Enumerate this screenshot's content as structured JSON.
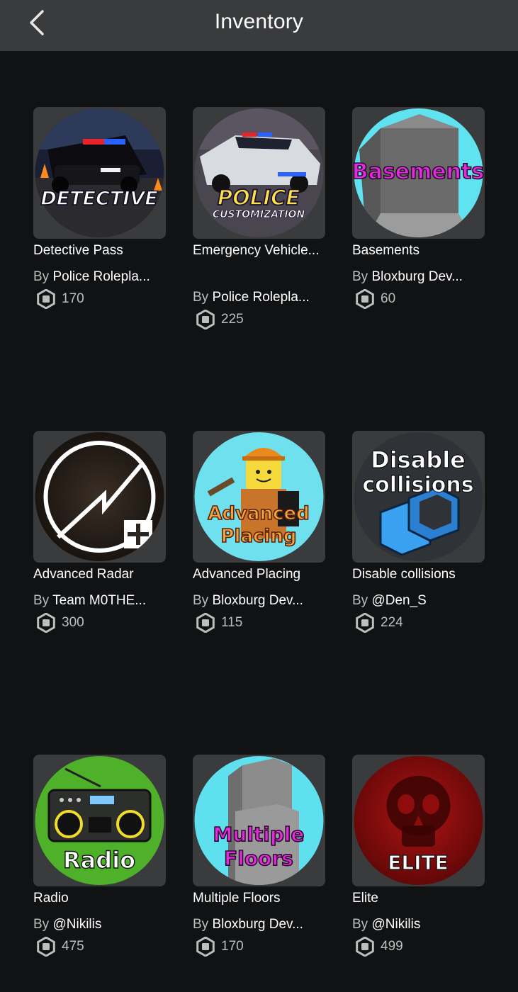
{
  "header": {
    "title": "Inventory"
  },
  "by_prefix": "By",
  "items": [
    {
      "name": "Detective Pass",
      "by": "By",
      "creator": "Police Rolepla...",
      "price": "170",
      "icon": "detective-thumbnail",
      "thumb_text": "DETECTIVE"
    },
    {
      "name": "Emergency Vehicle...",
      "by": "By",
      "creator": "Police Rolepla...",
      "price": "225",
      "icon": "police-customization-thumbnail",
      "thumb_text": "POLICE",
      "thumb_subtext": "CUSTOMIZATION"
    },
    {
      "name": "Basements",
      "by": "By",
      "creator": "Bloxburg Dev...",
      "price": "60",
      "icon": "basements-thumbnail",
      "thumb_text": "Basements"
    },
    {
      "name": "Advanced Radar",
      "by": "By",
      "creator": "Team M0THE...",
      "price": "300",
      "icon": "radar-thumbnail"
    },
    {
      "name": "Advanced Placing",
      "by": "By",
      "creator": "Bloxburg Dev...",
      "price": "115",
      "icon": "advanced-placing-thumbnail",
      "thumb_text": "Advanced",
      "thumb_subtext": "Placing"
    },
    {
      "name": "Disable collisions",
      "by": "By",
      "creator": "@Den_S",
      "price": "224",
      "icon": "disable-collisions-thumbnail",
      "thumb_text": "Disable",
      "thumb_subtext": "collisions"
    },
    {
      "name": "Radio",
      "by": "By",
      "creator": "@Nikilis",
      "price": "475",
      "icon": "radio-thumbnail",
      "thumb_text": "Radio"
    },
    {
      "name": "Multiple Floors",
      "by": "By",
      "creator": "Bloxburg Dev...",
      "price": "170",
      "icon": "multiple-floors-thumbnail",
      "thumb_text": "Multiple",
      "thumb_subtext": "Floors"
    },
    {
      "name": "Elite",
      "by": "By",
      "creator": "@Nikilis",
      "price": "499",
      "icon": "elite-thumbnail",
      "thumb_text": "ELITE"
    }
  ],
  "colors": {
    "background": "#111214",
    "header": "#393b3d",
    "card": "#393b3d",
    "text": "#ffffff",
    "secondary_text": "#bdbebe"
  }
}
